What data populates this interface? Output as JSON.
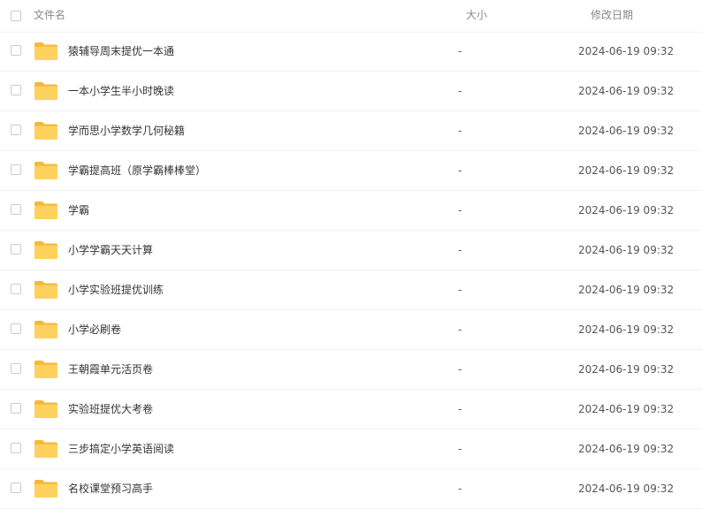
{
  "header": {
    "name_label": "文件名",
    "size_label": "大小",
    "date_label": "修改日期"
  },
  "icons": {
    "folder": "folder-icon",
    "folder_color": "#FFD25E"
  },
  "rows": [
    {
      "name": "猿辅导周末提优一本通",
      "size": "-",
      "date": "2024-06-19 09:32"
    },
    {
      "name": "一本小学生半小时晚读",
      "size": "-",
      "date": "2024-06-19 09:32"
    },
    {
      "name": "学而思小学数学几何秘籍",
      "size": "-",
      "date": "2024-06-19 09:32"
    },
    {
      "name": "学霸提高班（原学霸棒棒堂）",
      "size": "-",
      "date": "2024-06-19 09:32"
    },
    {
      "name": "学霸",
      "size": "-",
      "date": "2024-06-19 09:32"
    },
    {
      "name": "小学学霸天天计算",
      "size": "-",
      "date": "2024-06-19 09:32"
    },
    {
      "name": "小学实验班提优训练",
      "size": "-",
      "date": "2024-06-19 09:32"
    },
    {
      "name": "小学必刷卷",
      "size": "-",
      "date": "2024-06-19 09:32"
    },
    {
      "name": "王朝霞单元活页卷",
      "size": "-",
      "date": "2024-06-19 09:32"
    },
    {
      "name": "实验班提优大考卷",
      "size": "-",
      "date": "2024-06-19 09:32"
    },
    {
      "name": "三步搞定小学英语阅读",
      "size": "-",
      "date": "2024-06-19 09:32"
    },
    {
      "name": "名校课堂预习高手",
      "size": "-",
      "date": "2024-06-19 09:32"
    }
  ]
}
